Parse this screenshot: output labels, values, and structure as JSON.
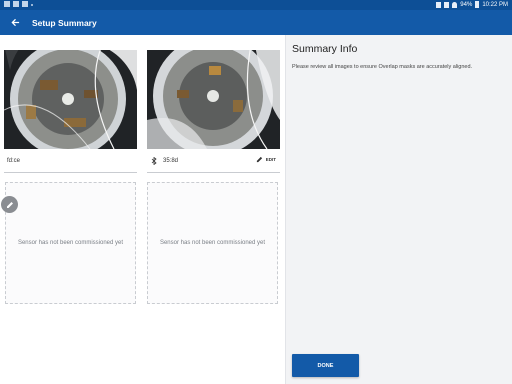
{
  "statusbar": {
    "battery": "94%",
    "time": "10:22 PM"
  },
  "appbar": {
    "title": "Setup Summary",
    "back_icon": "arrow-left-icon"
  },
  "sensors": [
    {
      "name": "fd:ce",
      "status": "commissioned"
    },
    {
      "name": "35:8d",
      "status": "commissioned",
      "edit_label": "EDIT",
      "icon": "bluetooth-icon"
    },
    {
      "message": "Sensor has not been commissioned yet"
    },
    {
      "message": "Sensor has not been commissioned yet"
    }
  ],
  "summary": {
    "title": "Summary Info",
    "description": "Please review all images to ensure Overlap masks are accurately aligned.",
    "done_label": "DONE"
  },
  "colors": {
    "primary": "#135aa8",
    "statusbar": "#0d4f96"
  }
}
